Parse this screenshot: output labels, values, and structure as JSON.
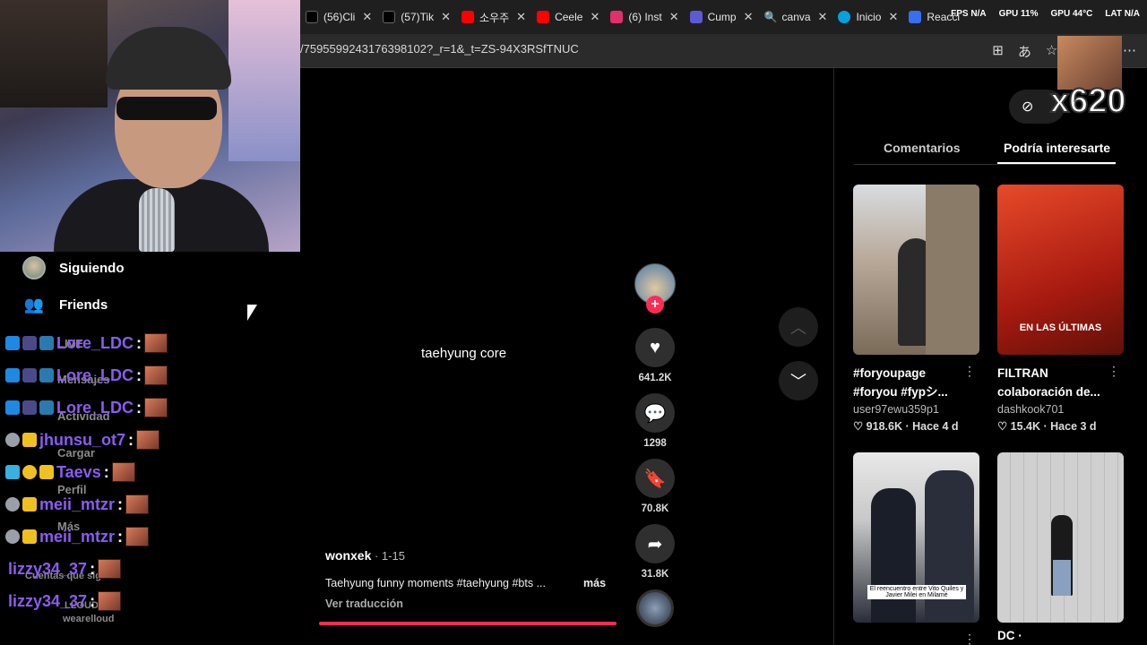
{
  "browser": {
    "tabs": [
      {
        "label": "(56)Cli",
        "icon_color": "#000000"
      },
      {
        "label": "(57)Tik",
        "icon_color": "#000000"
      },
      {
        "label": "소우주",
        "icon_color": "#ff0000"
      },
      {
        "label": "Ceele",
        "icon_color": "#ff0000"
      },
      {
        "label": "(6) Inst",
        "icon_color": "#e1306c"
      },
      {
        "label": "Cump",
        "icon_color": "#5b5bd6"
      },
      {
        "label": "canva",
        "icon_color": "#4a90e2"
      },
      {
        "label": "Inicio",
        "icon_color": "#00a3e0"
      },
      {
        "label": "Reacci",
        "icon_color": "#3a6ef0"
      }
    ],
    "url": "/7595599243176398102?_r=1&_t=ZS-94X3RSfTNUC",
    "stats": {
      "fps": "FPS N/A",
      "gpu": "GPU 11%",
      "gpu_temp": "GPU 44°C",
      "lat": "LAT N/A"
    }
  },
  "sidebar": {
    "following": "Siguiendo",
    "friends": "Friends",
    "faded_items": [
      "LIVE",
      "Mensajes",
      "Actividad",
      "Cargar",
      "Perfil",
      "Más",
      "Cuentas que sig",
      "LLOUD",
      "wearelloud"
    ]
  },
  "chat": [
    {
      "user": "Lore_LDC",
      "color": "#8a5cf0"
    },
    {
      "user": "Lore_LDC",
      "color": "#8a5cf0"
    },
    {
      "user": "Lore_LDC",
      "color": "#8a5cf0"
    },
    {
      "user": "jhunsu_ot7",
      "color": "#8a5cf0"
    },
    {
      "user": "Taevs",
      "color": "#8a5cf0"
    },
    {
      "user": "meii_mtzr",
      "color": "#8a5cf0"
    },
    {
      "user": "meii_mtzr",
      "color": "#8a5cf0"
    },
    {
      "user": "lizzy34_37",
      "color": "#8a5cf0"
    },
    {
      "user": "lizzy34_37",
      "color": "#8a5cf0"
    }
  ],
  "video": {
    "overlay_text": "taehyung core",
    "author": "wonxek",
    "date": " · 1-15",
    "description": "Taehyung funny moments #taehyung #bts ...",
    "more": "más",
    "translate": "Ver traducción",
    "likes": "641.2K",
    "comments": "1298",
    "saves": "70.8K",
    "shares": "31.8K"
  },
  "panel": {
    "tab_comments": "Comentarios",
    "tab_interest": "Podría interesarte",
    "cards": [
      {
        "title1": "#foryoupage",
        "title2": "#foryou #fypシ...",
        "user": "user97ewu359p1",
        "stats": "♡ 918.6K · Hace 4 d",
        "thumb_text": ""
      },
      {
        "title1": "FILTRAN",
        "title2": "colaboración de...",
        "user": "dashkook701",
        "stats": "♡ 15.4K · Hace 3 d",
        "thumb_text": "EN LAS ÚLTIMAS"
      },
      {
        "title1": "",
        "title2": "",
        "user": "",
        "stats": "",
        "thumb_text": "El reencuentro entre Vito Quiles y Javier Milei en Milamé"
      },
      {
        "title1": "DC · ",
        "title2": "",
        "user": "",
        "stats": "",
        "thumb_text": ""
      }
    ]
  },
  "overlay": {
    "counter": "x620"
  },
  "colors": {
    "accent": "#fe2c55",
    "chat_name": "#8a5cf0"
  }
}
